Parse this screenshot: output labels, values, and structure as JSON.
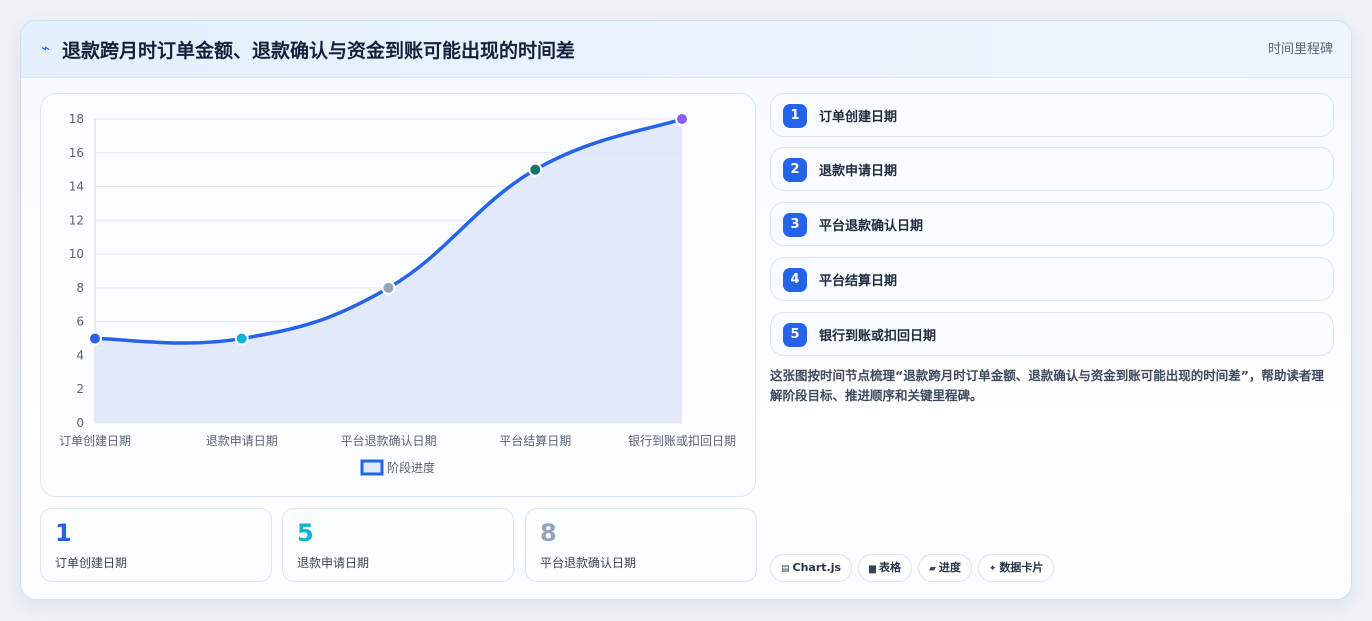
{
  "header": {
    "icon": "lightning-icon",
    "title": "退款跨月时订单金额、退款确认与资金到账可能出现的时间差",
    "tag": "时间里程碑"
  },
  "chart_data": {
    "type": "line",
    "categories": [
      "订单创建日期",
      "退款申请日期",
      "平台退款确认日期",
      "平台结算日期",
      "银行到账或扣回日期"
    ],
    "series": [
      {
        "name": "阶段进度",
        "values": [
          5,
          5,
          8,
          15,
          18
        ]
      }
    ],
    "point_colors": [
      "#2563eb",
      "#06b6d4",
      "#94a3b8",
      "#0f766e",
      "#8b5cf6"
    ],
    "line_color": "#2563eb",
    "fill_color": "#dfe7f8",
    "ylim": [
      0,
      18
    ],
    "yticks": [
      "0",
      "2",
      "4",
      "6",
      "8",
      "10",
      "12",
      "14",
      "16",
      "18"
    ],
    "grid": true,
    "legend": "bottom"
  },
  "stats": [
    {
      "value": "1",
      "label": "订单创建日期",
      "color": "#2563eb"
    },
    {
      "value": "5",
      "label": "退款申请日期",
      "color": "#06b6d4"
    },
    {
      "value": "8",
      "label": "平台退款确认日期",
      "color": "#94a3b8"
    }
  ],
  "steps": [
    {
      "num": "1",
      "label": "订单创建日期"
    },
    {
      "num": "2",
      "label": "退款申请日期"
    },
    {
      "num": "3",
      "label": "平台退款确认日期"
    },
    {
      "num": "4",
      "label": "平台结算日期"
    },
    {
      "num": "5",
      "label": "银行到账或扣回日期"
    }
  ],
  "description": "这张图按时间节点梳理“退款跨月时订单金额、退款确认与资金到账可能出现的时间差”，帮助读者理解阶段目标、推进顺序和关键里程碑。",
  "chips": [
    {
      "icon": "chart-icon",
      "glyph": "▤",
      "label": "Chart.js"
    },
    {
      "icon": "table-icon",
      "glyph": "▆",
      "label": "表格"
    },
    {
      "icon": "progress-icon",
      "glyph": "▰",
      "label": "进度"
    },
    {
      "icon": "card-icon",
      "glyph": "✦",
      "label": "数据卡片"
    }
  ]
}
